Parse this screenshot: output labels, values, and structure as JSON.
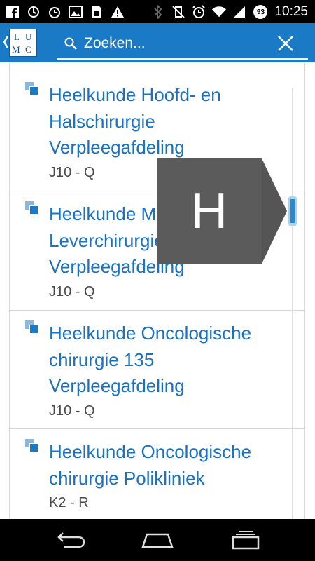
{
  "status_bar": {
    "left_icons": [
      "facebook-icon",
      "sync-icon",
      "alarm-icon",
      "image-icon",
      "sim-card-icon",
      "warning-icon"
    ],
    "right_icons": [
      "bluetooth-icon",
      "vibrate-off-icon",
      "alarm-clock-icon",
      "wifi-icon",
      "signal-icon",
      "battery-icon"
    ],
    "battery_level": "93",
    "time": "10:25"
  },
  "app_bar": {
    "logo": "LUMC",
    "search_placeholder": "Zoeken...",
    "accent": "#1a7ac5"
  },
  "results": [
    {
      "title": "Heelkunde Hoofd- en Halschirurgie Verpleegafdeling",
      "code": "J10 - Q"
    },
    {
      "title": "Heelkunde Maag-, Darm- en Leverchirurgie Verpleegafdeling",
      "code": "J10 - Q"
    },
    {
      "title": "Heelkunde Oncologische chirurgie 135 Verpleegafdeling",
      "code": "J10 - Q"
    },
    {
      "title": "Heelkunde Oncologische chirurgie Polikliniek",
      "code": "K2 - R"
    }
  ],
  "fast_scroll": {
    "letter": "H"
  },
  "nav_bar": {
    "icons": [
      "back-icon",
      "home-icon",
      "recents-icon"
    ]
  }
}
